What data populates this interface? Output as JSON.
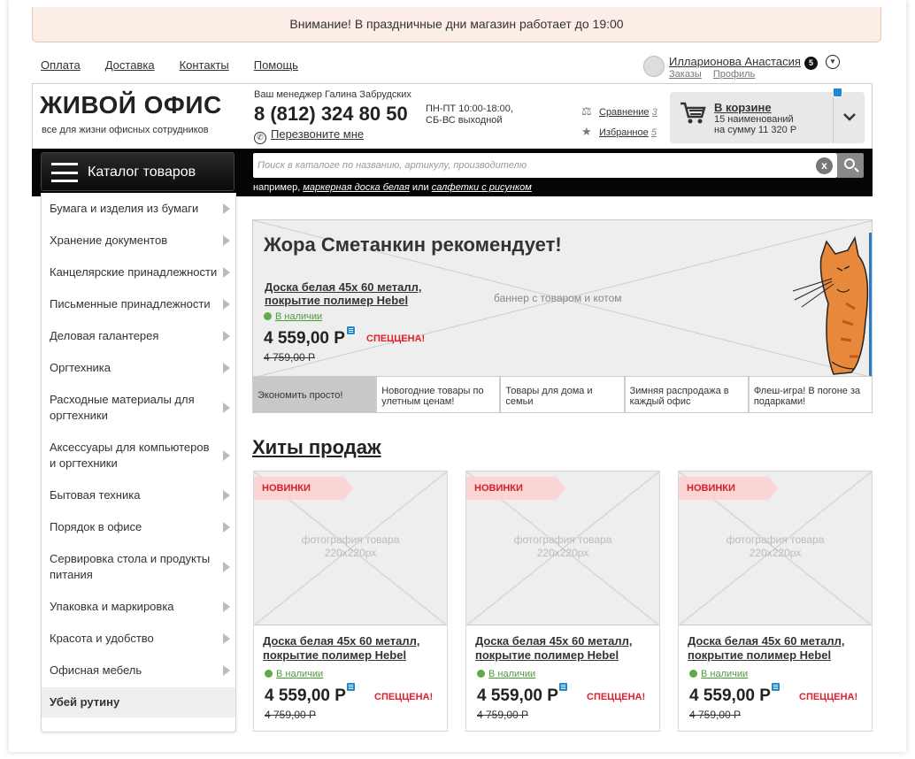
{
  "notice": "Внимание! В праздничные дни магазин работает до 19:00",
  "toplinks": [
    "Оплата",
    "Доставка",
    "Контакты",
    "Помощь"
  ],
  "user": {
    "name": "Илларионова Анастасия",
    "count": "5",
    "orders": "Заказы",
    "profile": "Профиль"
  },
  "header": {
    "logo": "ЖИВОЙ ОФИС",
    "tagline": "все для жизни офисных сотрудников",
    "manager": "Ваш менеджер Галина Забрудских",
    "phone": "8 (812) 324 80 50",
    "callback": "Перезвоните мне",
    "hours": "ПН-ПТ 10:00-18:00,\nСБ-ВС выходной",
    "compare_label": "Сравнение",
    "compare_count": "3",
    "favorites_label": "Избранное",
    "favorites_count": "5"
  },
  "cart": {
    "title": "В корзине",
    "lines": "15 наименований\nна сумму 11 320 Р"
  },
  "catalog_button": "Каталог товаров",
  "search": {
    "placeholder": "Поиск в каталоге по названию, артикулу, производителю",
    "clear": "x",
    "example_prefix": "например,",
    "example_1": "маркерная доска белая",
    "example_or": "или",
    "example_2": "салфетки с рисунком"
  },
  "menu": [
    "Бумага и изделия из бумаги",
    "Хранение документов",
    "Канцелярские принадлежности",
    "Письменные принадлежности",
    "Деловая галантерея",
    "Оргтехника",
    "Расходные материалы для оргтехники",
    "Аксессуары для компьютеров и оргтехники",
    "Бытовая техника",
    "Порядок в офисе",
    "Сервировка стола и продукты питания",
    "Упаковка и маркировка",
    "Красота и удобство",
    "Офисная мебель",
    "Убей рутину"
  ],
  "banner": {
    "title": "Жора Сметанкин рекомендует!",
    "product": "Доска белая 45х 60 металл, покрытие полимер Hebel",
    "stock": "В наличии",
    "price": "4 559,00 Р",
    "sale": "СПЕЦЦЕНА!",
    "old": "4 759,00 Р",
    "placeholder": "баннер с товаром и котом",
    "tabs": [
      "Экономить просто!",
      "Новогодние товары по улетным ценам!",
      "Товары для дома и семьи",
      "Зимняя распродажа в каждый офис",
      "Флеш-игра! В погоне за подарками!"
    ]
  },
  "hits_title": "Хиты продаж",
  "products": [
    {
      "badge": "НОВИНКИ",
      "placeholder": "фотография товара\n220х220рх",
      "name": "Доска белая 45х 60 металл, покрытие полимер Hebel",
      "stock": "В наличии",
      "price": "4 559,00 Р",
      "sale": "СПЕЦЦЕНА!",
      "old": "4 759,00 Р"
    },
    {
      "badge": "НОВИНКИ",
      "placeholder": "фотография товара\n220х220рх",
      "name": "Доска белая 45х 60 металл, покрытие полимер Hebel",
      "stock": "В наличии",
      "price": "4 559,00 Р",
      "sale": "СПЕЦЦЕНА!",
      "old": "4 759,00 Р"
    },
    {
      "badge": "НОВИНКИ",
      "placeholder": "фотография товара\n220х220рх",
      "name": "Доска белая 45х 60 металл, покрытие полимер Hebel",
      "stock": "В наличии",
      "price": "4 559,00 Р",
      "sale": "СПЕЦЦЕНА!",
      "old": "4 759,00 Р"
    }
  ],
  "colors": {
    "notice_bg": "#fbeee6",
    "sale_red": "#e0202c",
    "stock_green": "#5cac4c",
    "badge_blue": "#1e88d4"
  }
}
